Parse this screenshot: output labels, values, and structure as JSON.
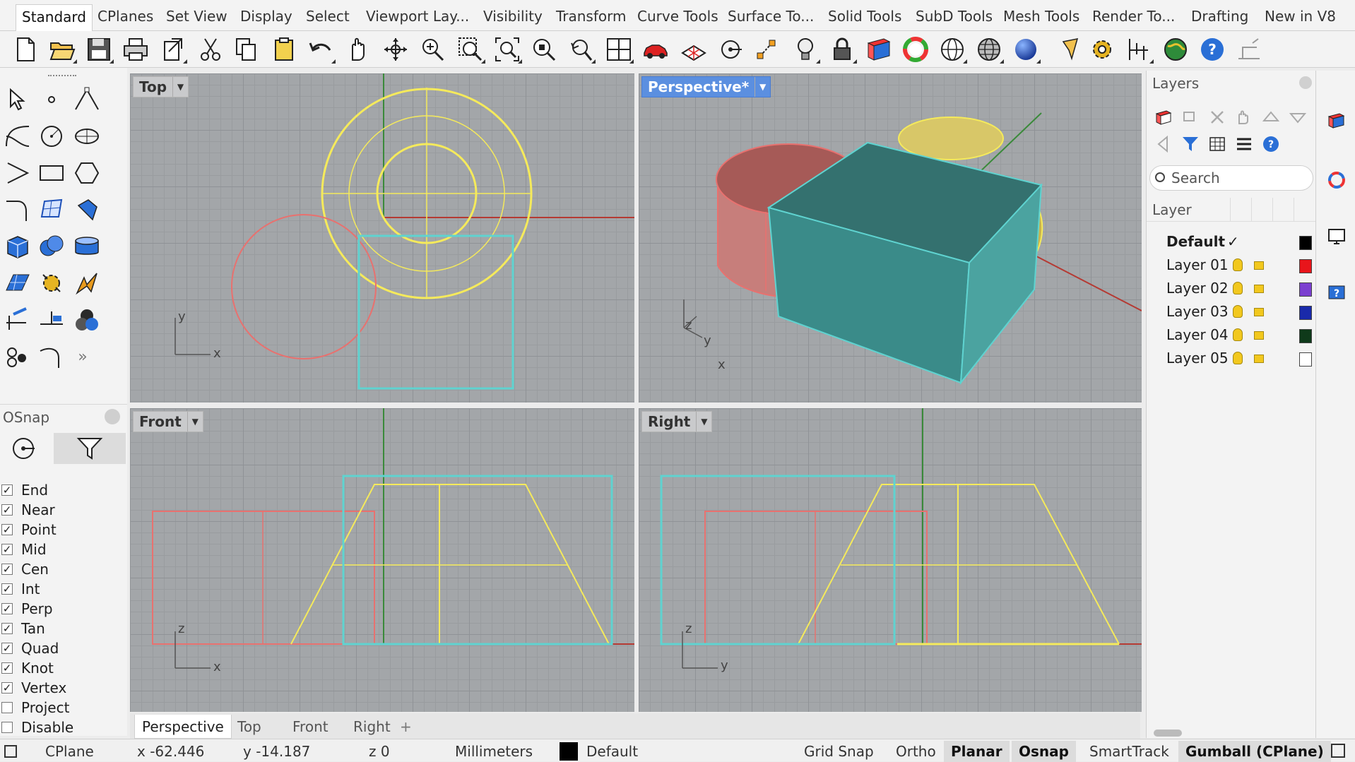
{
  "menu_tabs": [
    "Standard",
    "CPlanes",
    "Set View",
    "Display",
    "Select",
    "Viewport Lay...",
    "Visibility",
    "Transform",
    "Curve Tools",
    "Surface To...",
    "Solid Tools",
    "SubD Tools",
    "Mesh Tools",
    "Render To...",
    "Drafting",
    "New in V8"
  ],
  "active_tab": "Standard",
  "toolbar_icons": [
    "new-file-icon",
    "open-folder-icon",
    "save-icon",
    "print-icon",
    "import-icon",
    "cut-icon",
    "copy-icon",
    "paste-icon",
    "undo-icon",
    "pan-hand-icon",
    "rotate-view-icon",
    "zoom-in-icon",
    "zoom-window-icon",
    "zoom-extents-icon",
    "zoom-selected-icon",
    "undo-view-icon",
    "four-viewports-icon",
    "car-icon",
    "grid-plane-icon",
    "osnap-target-icon",
    "scale-points-icon",
    "lightbulb-icon",
    "lock-icon",
    "layer-book-icon",
    "color-wheel-icon",
    "wire-sphere-icon",
    "shaded-sphere-icon",
    "rendered-sphere-icon",
    "pencil-flag-icon",
    "gear-options-icon",
    "dimension-icon",
    "globe-icon",
    "help-icon",
    "panel-icon"
  ],
  "viewports": {
    "top": {
      "title": "Top",
      "ax1": "y",
      "ax2": "x"
    },
    "perspective": {
      "title": "Perspective*",
      "ax1": "z",
      "ax2": "y",
      "ax3": "x"
    },
    "front": {
      "title": "Front",
      "ax1": "z",
      "ax2": "x"
    },
    "right": {
      "title": "Right",
      "ax1": "z",
      "ax2": "y"
    }
  },
  "viewport_tabs": [
    "Perspective",
    "Top",
    "Front",
    "Right"
  ],
  "active_viewport_tab": "Perspective",
  "osnap": {
    "title": "OSnap",
    "items": [
      {
        "label": "End",
        "checked": true
      },
      {
        "label": "Near",
        "checked": true
      },
      {
        "label": "Point",
        "checked": true
      },
      {
        "label": "Mid",
        "checked": true
      },
      {
        "label": "Cen",
        "checked": true
      },
      {
        "label": "Int",
        "checked": true
      },
      {
        "label": "Perp",
        "checked": true
      },
      {
        "label": "Tan",
        "checked": true
      },
      {
        "label": "Quad",
        "checked": true
      },
      {
        "label": "Knot",
        "checked": true
      },
      {
        "label": "Vertex",
        "checked": true
      },
      {
        "label": "Project",
        "checked": false
      },
      {
        "label": "Disable",
        "checked": false
      }
    ],
    "check_mark": "✓"
  },
  "layers": {
    "title": "Layers",
    "search_placeholder": "Search",
    "column_header": "Layer",
    "current_mark": "✓",
    "rows": [
      {
        "name": "Default",
        "color": "#000000",
        "current": true
      },
      {
        "name": "Layer 01",
        "color": "#e8151b"
      },
      {
        "name": "Layer 02",
        "color": "#7b3fd0"
      },
      {
        "name": "Layer 03",
        "color": "#1a2aaa"
      },
      {
        "name": "Layer 04",
        "color": "#0f3a1a"
      },
      {
        "name": "Layer 05",
        "color": "#ffffff"
      }
    ]
  },
  "colors": {
    "yellow_curve": "#f5ea5b",
    "red_curve": "#e8716f",
    "cyan_curve": "#5fd3d0",
    "box_fill": "#3a8b89",
    "accent_blue": "#5b8fe0"
  },
  "status": {
    "cplane": "CPlane",
    "x": "x -62.446",
    "y": "y -14.187",
    "z": "z 0",
    "units": "Millimeters",
    "layer": "Default",
    "grid_snap": "Grid Snap",
    "ortho": "Ortho",
    "planar": "Planar",
    "osnap": "Osnap",
    "smarttrack": "SmartTrack",
    "gumball": "Gumball (CPlane)"
  }
}
